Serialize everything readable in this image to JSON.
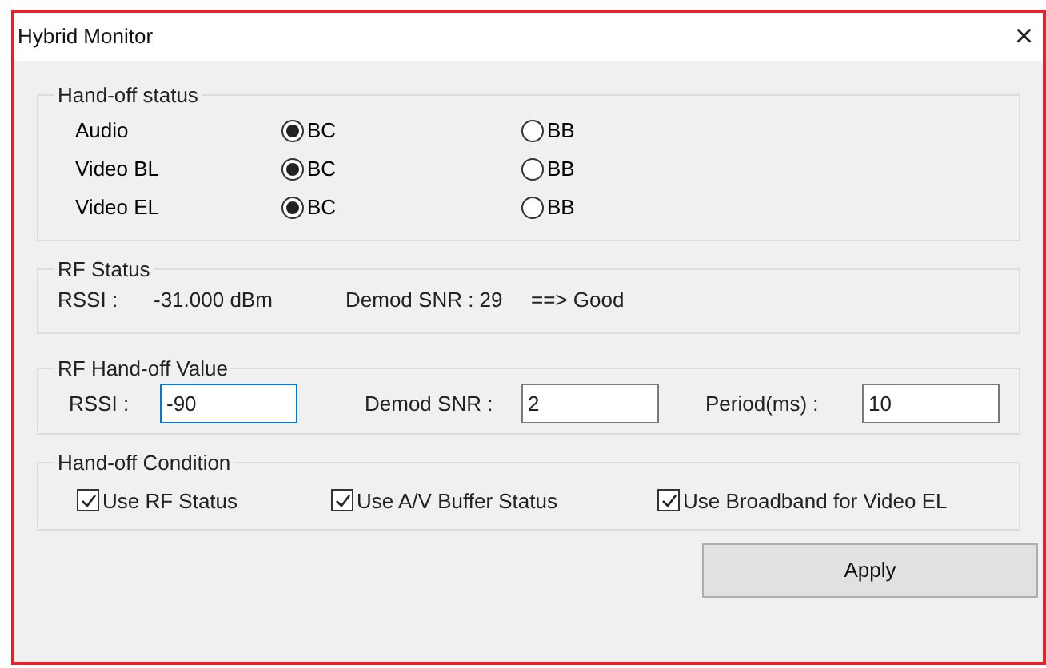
{
  "window": {
    "title": "Hybrid Monitor",
    "close": "×"
  },
  "handoff_status": {
    "title": "Hand-off status",
    "rows": [
      {
        "label": "Audio",
        "options": [
          {
            "label": "BC",
            "selected": true
          },
          {
            "label": "BB",
            "selected": false
          }
        ]
      },
      {
        "label": "Video BL",
        "options": [
          {
            "label": "BC",
            "selected": true
          },
          {
            "label": "BB",
            "selected": false
          }
        ]
      },
      {
        "label": "Video EL",
        "options": [
          {
            "label": "BC",
            "selected": true
          },
          {
            "label": "BB",
            "selected": false
          }
        ]
      }
    ]
  },
  "rf_status": {
    "title": "RF Status",
    "items": [
      "RSSI :",
      "-31.000 dBm",
      "Demod SNR : 29",
      "==> Good"
    ]
  },
  "rf_handoff_value": {
    "title": "RF Hand-off Value",
    "fields": [
      {
        "label": "RSSI :",
        "value": "-90",
        "focused": true
      },
      {
        "label": "Demod SNR :",
        "value": "2",
        "focused": false
      },
      {
        "label": "Period(ms) :",
        "value": "10",
        "focused": false
      }
    ]
  },
  "handoff_condition": {
    "title": "Hand-off Condition",
    "checkboxes": [
      {
        "label": "Use RF Status",
        "checked": true
      },
      {
        "label": "Use A/V Buffer Status",
        "checked": true
      },
      {
        "label": "Use Broadband for Video EL",
        "checked": true
      }
    ]
  },
  "buttons": [
    "Apply"
  ]
}
